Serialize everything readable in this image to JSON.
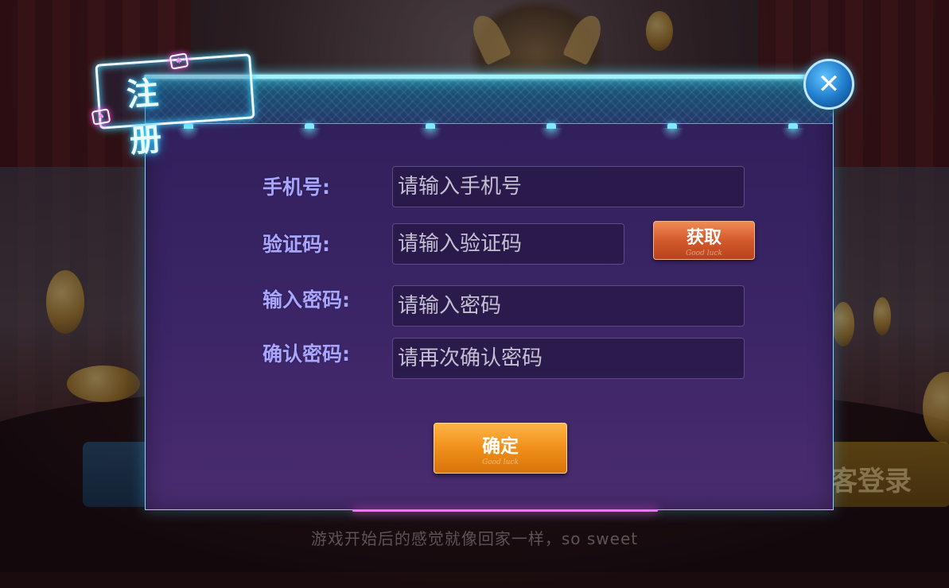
{
  "background": {
    "slogan": "游戏开始后的感觉就像回家一样，so sweet",
    "guest_login_partial": "客登录"
  },
  "dialog": {
    "title": "注 册",
    "close_icon": "close-icon",
    "fields": [
      {
        "label": "手机号:",
        "placeholder": "请输入手机号"
      },
      {
        "label": "验证码:",
        "placeholder": "请输入验证码"
      },
      {
        "label": "输入密码:",
        "placeholder": "请输入密码"
      },
      {
        "label": "确认密码:",
        "placeholder": "请再次确认密码"
      }
    ],
    "get_code_button": {
      "label": "获取",
      "sub": "Good luck"
    },
    "confirm_button": {
      "label": "确定",
      "sub": "Good luck"
    }
  },
  "colors": {
    "panel": "#3b2566",
    "label": "#a9a6ff",
    "neon_cyan": "#52e3ff",
    "neon_pink": "#ff3ee8",
    "get_button": "#d45a2c",
    "confirm_button": "#f08f1a"
  }
}
